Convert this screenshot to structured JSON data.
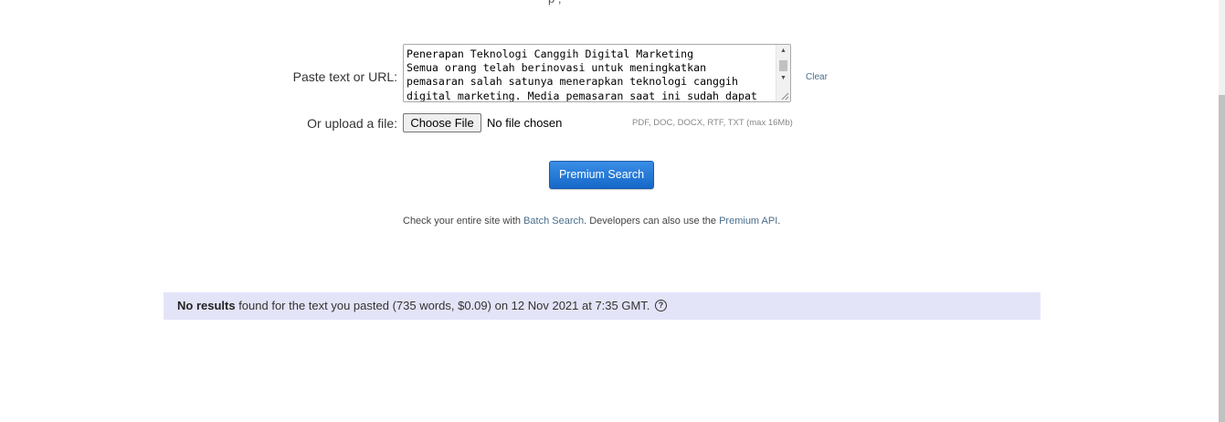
{
  "header_cut_text": "p     ,",
  "form": {
    "paste_label": "Paste text or URL:",
    "paste_value_lines": [
      "Penerapan Teknologi Canggih Digital Marketing",
      "Semua orang telah berinovasi untuk meningkatkan",
      "pemasaran salah satunya menerapkan teknologi canggih",
      "digital marketing. Media pemasaran saat ini sudah dapat"
    ],
    "clear_label": "Clear",
    "upload_label": "Or upload a file:",
    "choose_file_label": "Choose File",
    "file_status": "No file chosen",
    "file_types": "PDF, DOC, DOCX, RTF, TXT (max 16Mb)",
    "premium_search_label": "Premium Search"
  },
  "info": {
    "prefix": "Check your entire site with ",
    "batch_link": "Batch Search",
    "middle": ". Developers can also use the ",
    "api_link": "Premium API",
    "suffix": "."
  },
  "results": {
    "bold": "No results",
    "text": " found for the text you pasted (735 words, $0.09) on 12 Nov 2021 at 7:35 GMT.",
    "help_glyph": "?"
  },
  "icons": {
    "scroll_up": "▲",
    "scroll_down": "▼"
  },
  "colors": {
    "accent_blue": "#1668c9",
    "link": "#4a6e8c",
    "results_bg": "#e4e4f8"
  }
}
